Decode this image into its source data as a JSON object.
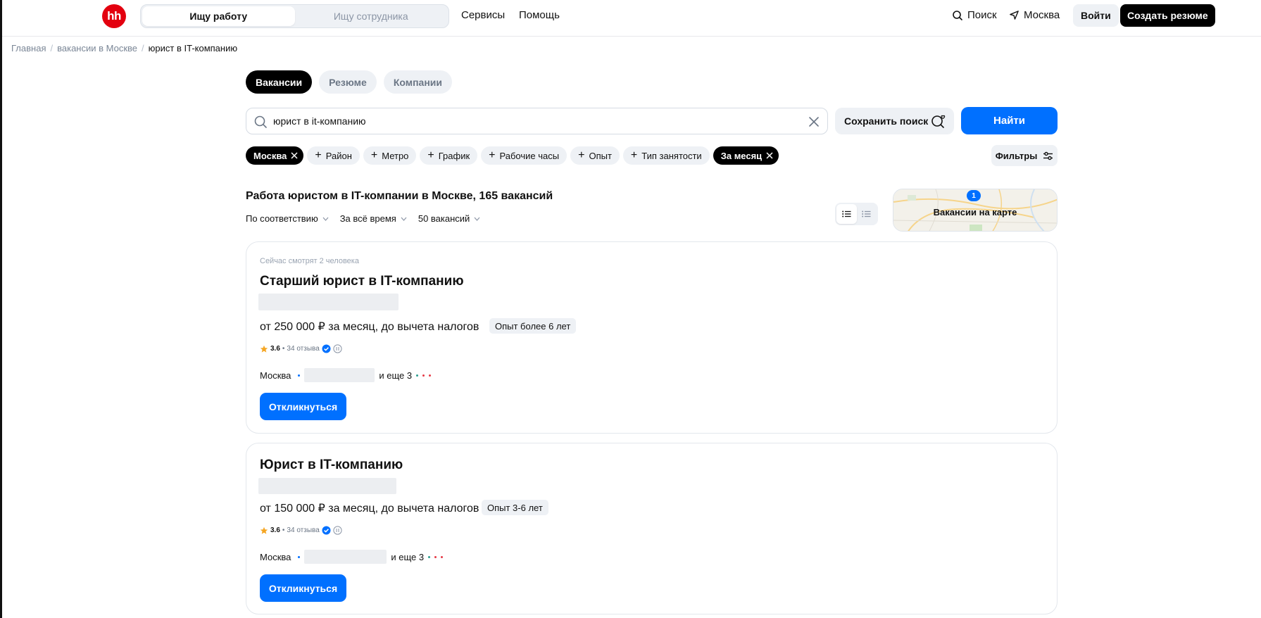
{
  "header": {
    "logo_text": "hh",
    "segment": [
      "Ищу работу",
      "Ищу сотрудника"
    ],
    "nav": [
      "Сервисы",
      "Помощь"
    ],
    "search_label": "Поиск",
    "city_label": "Москва",
    "login_label": "Войти",
    "create_resume_label": "Создать резюме"
  },
  "breadcrumb": [
    "Главная",
    "вакансии в Москве",
    "юрист в IT-компанию"
  ],
  "tabs": [
    "Вакансии",
    "Резюме",
    "Компании"
  ],
  "search": {
    "value": "юрист в it-компанию",
    "save_label": "Сохранить поиск",
    "find_label": "Найти"
  },
  "chips": {
    "city": "Москва",
    "items": [
      "Район",
      "Метро",
      "График",
      "Рабочие часы",
      "Опыт",
      "Тип занятости"
    ],
    "period": "За месяц",
    "filters_label": "Фильтры"
  },
  "results": {
    "title": "Работа юристом в IT-компании в Москве, 165 вакансий",
    "sort": [
      "По соответствию",
      "За всё время",
      "50 вакансий"
    ],
    "map_label": "Вакансии на карте",
    "map_count": "1"
  },
  "vacancies": [
    {
      "watching": "Сейчас смотрят 2 человека",
      "title": "Старший юрист в IT-компанию",
      "salary": "от 250 000 ₽ за месяц, до вычета налогов",
      "experience": "Опыт более 6 лет",
      "rating": "3.6",
      "reviews": "34 отзыва",
      "city": "Москва",
      "more": "и еще 3",
      "apply_label": "Откликнуться"
    },
    {
      "title": "Юрист в IT-компанию",
      "salary": "от 150 000 ₽ за месяц, до вычета налогов",
      "experience": "Опыт 3-6 лет",
      "rating": "3.6",
      "reviews": "34 отзыва",
      "city": "Москва",
      "more": "и еще 3",
      "apply_label": "Откликнуться"
    }
  ],
  "colors": {
    "brand": "#e3000f",
    "accent": "#0070ff"
  }
}
